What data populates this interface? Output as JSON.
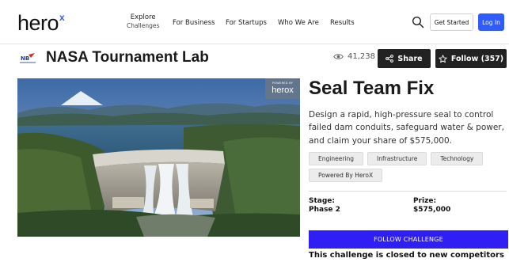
{
  "header": {
    "logo_text": "hero",
    "logo_mark": "x",
    "nav": [
      {
        "label": "Explore",
        "sub": "Challenges"
      },
      {
        "label": "For Business"
      },
      {
        "label": "For Startups"
      },
      {
        "label": "Who We Are"
      },
      {
        "label": "Results"
      }
    ],
    "search_icon": "search-icon",
    "get_started_label": "Get Started",
    "login_label": "Log In"
  },
  "org": {
    "name": "NASA Tournament Lab",
    "views": "41,238",
    "share_label": "Share",
    "follow_label": "Follow (357)"
  },
  "image": {
    "badge_top": "POWERED BY",
    "badge_logo": "herox"
  },
  "challenge": {
    "title": "Seal Team Fix",
    "description": "Design a rapid, high-pressure seal to control failed dam conduits, safeguard water & power, and claim your share of $575,000.",
    "tags": [
      "Engineering",
      "Infrastructure",
      "Technology",
      "Powered By HeroX"
    ],
    "stage_label": "Stage:",
    "stage_value": "Phase 2",
    "prize_label": "Prize:",
    "prize_value": "$575,000",
    "follow_button": "FOLLOW CHALLENGE",
    "closed_note": "This challenge is closed to new competitors"
  },
  "colors": {
    "brand_blue": "#2f5bff",
    "cta_blue": "#2f1ff5",
    "dark_button": "#222222"
  }
}
